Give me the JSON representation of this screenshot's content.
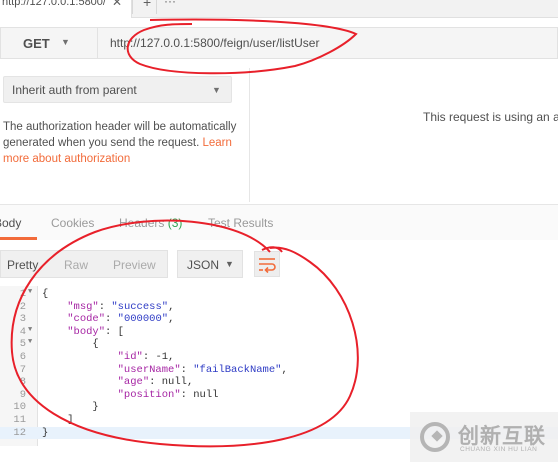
{
  "tabs": {
    "active_title": "http://127.0.0.1:5800/",
    "close_icon": "close-icon",
    "add_label": "+",
    "more_label": "···"
  },
  "request": {
    "method": "GET",
    "url": "http://127.0.0.1:5800/feign/user/listUser"
  },
  "auth": {
    "type": "Inherit auth from parent",
    "description": "The authorization header will be automatically generated when you send the request. ",
    "link": "Learn more about authorization",
    "right_message": "This request is using an au"
  },
  "response": {
    "tabs": [
      {
        "label": "Body",
        "active": true
      },
      {
        "label": "Cookies",
        "active": false
      },
      {
        "label": "Headers",
        "active": false,
        "badge": "(3)"
      },
      {
        "label": "Test Results",
        "active": false
      }
    ],
    "view_modes": [
      "Pretty",
      "Raw",
      "Preview"
    ],
    "active_view": "Pretty",
    "format": "JSON",
    "wrap_icon": "wrap-lines-icon",
    "lines": [
      "{",
      "    \"msg\": \"success\",",
      "    \"code\": \"000000\",",
      "    \"body\": [",
      "        {",
      "            \"id\": -1,",
      "            \"userName\": \"failBackName\",",
      "            \"age\": null,",
      "            \"position\": null",
      "        }",
      "    ]",
      "}"
    ],
    "line_numbers": [
      "1",
      "2",
      "3",
      "4",
      "5",
      "6",
      "7",
      "8",
      "9",
      "10",
      "11",
      "12"
    ],
    "highlighted_line": 12
  },
  "watermark": {
    "text": "创新互联",
    "subtext": "CHUANG XIN HU LIAN"
  },
  "colors": {
    "accent": "#f26b3a",
    "annotation": "#e8202a",
    "badge": "#2ea44f"
  }
}
